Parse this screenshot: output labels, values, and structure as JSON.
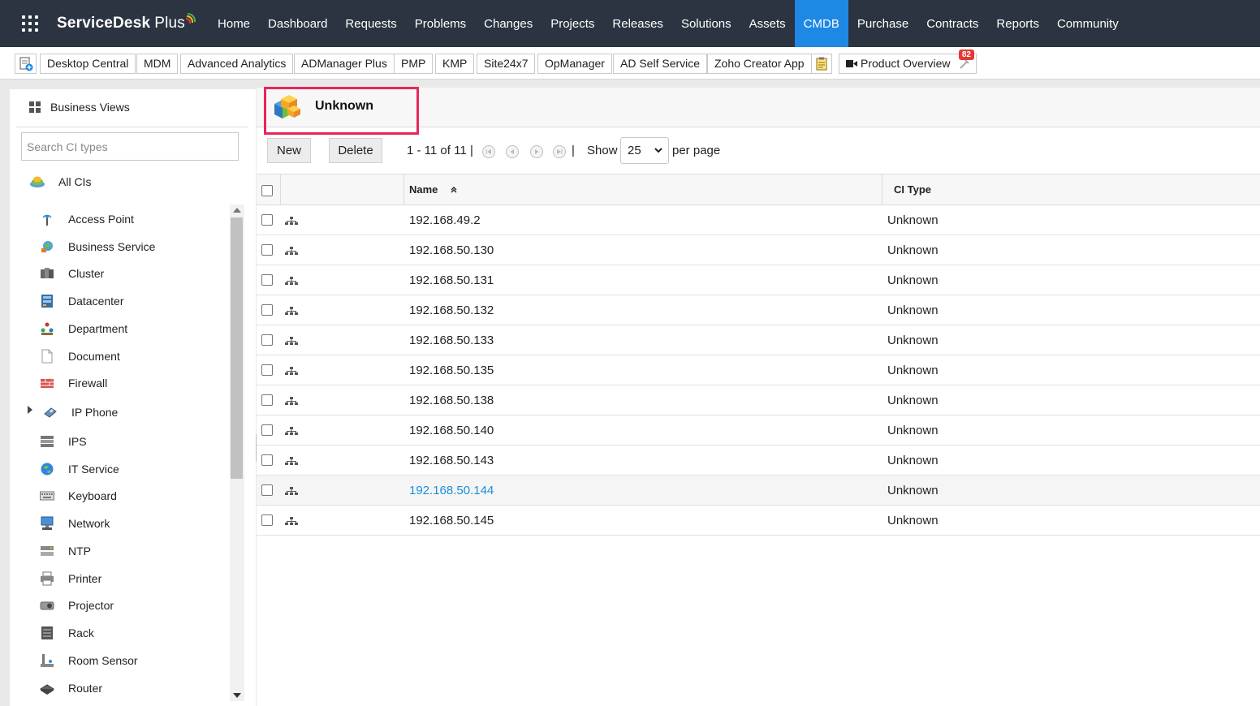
{
  "app": {
    "brand": "ServiceDesk",
    "brand_suffix": "Plus"
  },
  "nav": {
    "items": [
      "Home",
      "Dashboard",
      "Requests",
      "Problems",
      "Changes",
      "Projects",
      "Releases",
      "Solutions",
      "Assets",
      "CMDB",
      "Purchase",
      "Contracts",
      "Reports",
      "Community"
    ],
    "active": "CMDB"
  },
  "quicklinks": {
    "items": [
      "Desktop Central",
      "MDM",
      "Advanced Analytics",
      "ADManager Plus",
      "PMP",
      "KMP",
      "Site24x7",
      "OpManager",
      "AD Self Service",
      "Zoho Creator App"
    ],
    "product_overview": "Product Overview",
    "badge_count": "82"
  },
  "sidebar": {
    "business_views": "Business Views",
    "search_placeholder": "Search CI types",
    "all_cis": "All CIs",
    "ci_types": [
      {
        "label": "Access Point",
        "icon": "access-point-icon"
      },
      {
        "label": "Business Service",
        "icon": "business-service-icon"
      },
      {
        "label": "Cluster",
        "icon": "cluster-icon"
      },
      {
        "label": "Datacenter",
        "icon": "datacenter-icon"
      },
      {
        "label": "Department",
        "icon": "department-icon"
      },
      {
        "label": "Document",
        "icon": "document-icon"
      },
      {
        "label": "Firewall",
        "icon": "firewall-icon"
      },
      {
        "label": "IP Phone",
        "icon": "ip-phone-icon"
      },
      {
        "label": "IPS",
        "icon": "ips-icon"
      },
      {
        "label": "IT Service",
        "icon": "it-service-icon"
      },
      {
        "label": "Keyboard",
        "icon": "keyboard-icon"
      },
      {
        "label": "Network",
        "icon": "network-icon"
      },
      {
        "label": "NTP",
        "icon": "ntp-icon"
      },
      {
        "label": "Printer",
        "icon": "printer-icon"
      },
      {
        "label": "Projector",
        "icon": "projector-icon"
      },
      {
        "label": "Rack",
        "icon": "rack-icon"
      },
      {
        "label": "Room Sensor",
        "icon": "room-sensor-icon"
      },
      {
        "label": "Router",
        "icon": "router-icon"
      }
    ]
  },
  "main": {
    "title": "Unknown",
    "new_label": "New",
    "delete_label": "Delete",
    "pager": {
      "range": "1 - 11 of 11",
      "show_label": "Show",
      "per_page_value": "25",
      "per_page_label": "per page"
    },
    "columns": {
      "name": "Name",
      "ci_type": "CI Type"
    },
    "rows": [
      {
        "name": "192.168.49.2",
        "ci_type": "Unknown"
      },
      {
        "name": "192.168.50.130",
        "ci_type": "Unknown"
      },
      {
        "name": "192.168.50.131",
        "ci_type": "Unknown"
      },
      {
        "name": "192.168.50.132",
        "ci_type": "Unknown"
      },
      {
        "name": "192.168.50.133",
        "ci_type": "Unknown"
      },
      {
        "name": "192.168.50.135",
        "ci_type": "Unknown"
      },
      {
        "name": "192.168.50.138",
        "ci_type": "Unknown"
      },
      {
        "name": "192.168.50.140",
        "ci_type": "Unknown"
      },
      {
        "name": "192.168.50.143",
        "ci_type": "Unknown"
      },
      {
        "name": "192.168.50.144",
        "ci_type": "Unknown",
        "hovered": true
      },
      {
        "name": "192.168.50.145",
        "ci_type": "Unknown"
      }
    ]
  },
  "colors": {
    "topbar": "#2b3440",
    "active_tab": "#1e88e5",
    "highlight": "#e8265a",
    "link": "#1a8fd8",
    "badge": "#e53935"
  }
}
